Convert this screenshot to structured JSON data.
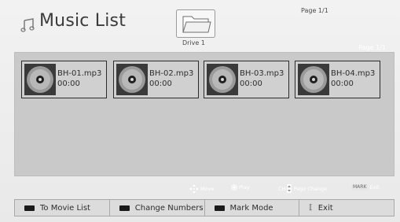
{
  "header": {
    "title": "Music List",
    "app_icon": "music-note-icon",
    "drive_icon": "folder-icon",
    "drive_label": "Drive 1",
    "page_top": "Page 1/1"
  },
  "content": {
    "page_label": "Page 1/1",
    "files": [
      {
        "name": "BH-01.mp3",
        "time": "00:00",
        "icon": "cd-icon"
      },
      {
        "name": "BH-02.mp3",
        "time": "00:00",
        "icon": "cd-icon"
      },
      {
        "name": "BH-03.mp3",
        "time": "00:00",
        "icon": "cd-icon"
      },
      {
        "name": "BH-04.mp3",
        "time": "00:00",
        "icon": "cd-icon"
      }
    ]
  },
  "hints": {
    "move": "Move",
    "play": "Play",
    "ch_label": "CH",
    "page_change": "Page Change",
    "mark_key": "MARK",
    "exit": "Exit"
  },
  "bottom_bar": {
    "to_movie_list": "To Movie List",
    "change_numbers": "Change Numbers",
    "mark_mode": "Mark Mode",
    "exit": "Exit"
  },
  "colors": {
    "background": "#ececec",
    "content_panel": "#c9c9c9",
    "text": "#3b3b3b",
    "hint_text": "#ffffff"
  }
}
